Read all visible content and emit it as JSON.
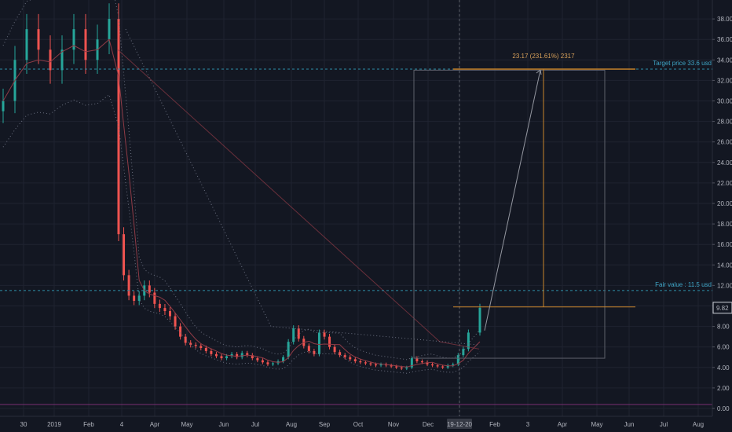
{
  "chart_data": {
    "type": "candlestick",
    "colors": {
      "background": "#131722",
      "grid": "#1f2330",
      "up": "#26a69a",
      "down": "#ef5350",
      "ma": "#8e3b46",
      "envelope": "#6b7080",
      "target_line": "#2e8fa8",
      "projection": "#c8842a",
      "box": "#5d606b",
      "axis_text": "#b2b5be",
      "zero_line": "#7b2f72"
    },
    "ylim": [
      -0.2,
      40
    ],
    "y_ticks": [
      "0.00",
      "2.00",
      "4.00",
      "6.00",
      "8.00",
      "10.00",
      "12.00",
      "14.00",
      "16.00",
      "18.00",
      "20.00",
      "22.00",
      "24.00",
      "26.00",
      "28.00",
      "30.00",
      "32.00",
      "34.00",
      "36.00",
      "38.00"
    ],
    "x_ticks": [
      "30",
      "2019",
      "Feb",
      "4",
      "Apr",
      "May",
      "Jun",
      "Jul",
      "Aug",
      "Sep",
      "Oct",
      "Nov",
      "Dec",
      "19-12-20",
      "Feb",
      "3",
      "Apr",
      "May",
      "Jun",
      "Jul",
      "Aug"
    ],
    "price_badge": "9.82",
    "target_label": "Target price 33.6 usd",
    "target_value": 33.1,
    "fair_label": "Fair value : 11.5 usd",
    "fair_value": 11.5,
    "projection_label": "23.17 (231.61%) 2317",
    "projection_from": 9.9,
    "projection_to": 33.1,
    "box_range": [
      4.9,
      33.0
    ],
    "last_close": 9.82,
    "prices": [
      30,
      34,
      37,
      35,
      33,
      35,
      37,
      34,
      36,
      38,
      17,
      13,
      11,
      10.5,
      11,
      12,
      11.3,
      10.2,
      9.8,
      9.5,
      9,
      8,
      7,
      6.4,
      6.2,
      6.1,
      5.9,
      5.6,
      5.3,
      5.1,
      4.9,
      5.1,
      5.3,
      5.0,
      5.4,
      5.2,
      4.9,
      4.7,
      4.5,
      4.3,
      4.4,
      4.6,
      5.0,
      6.5,
      7.8,
      6.8,
      6.1,
      5.6,
      5.3,
      7.4,
      7.0,
      6.0,
      5.5,
      5.2,
      5.0,
      4.8,
      4.6,
      4.5,
      4.4,
      4.3,
      4.2,
      4.3,
      4.2,
      4.1,
      4.0,
      3.9,
      4.0,
      4.9,
      4.6,
      4.5,
      4.3,
      4.2,
      4.1,
      4.0,
      4.2,
      4.3,
      5.2,
      5.8,
      7.4,
      9.82
    ]
  }
}
